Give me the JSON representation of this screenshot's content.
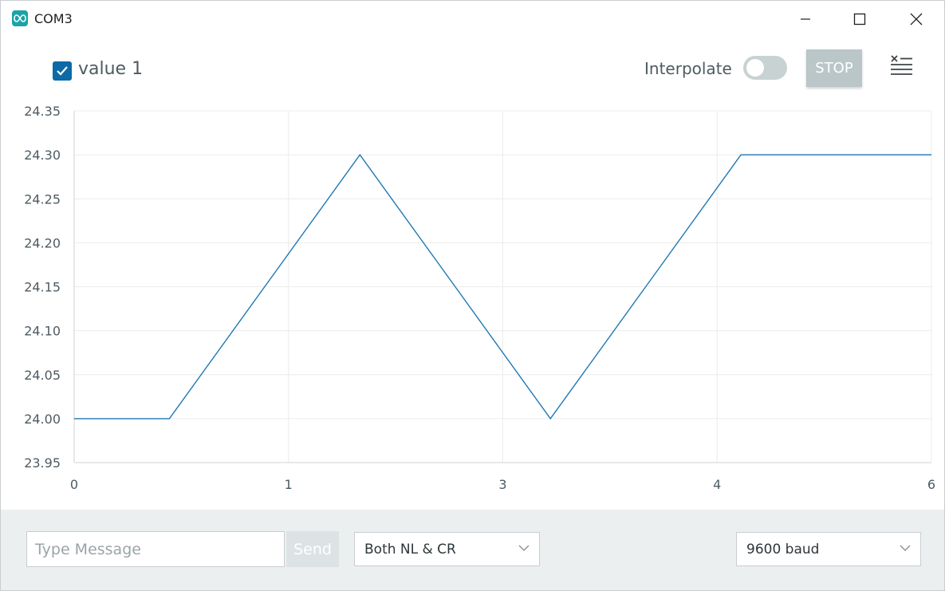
{
  "window": {
    "title": "COM3"
  },
  "toolbar": {
    "series_label": "value 1",
    "series_checked": true,
    "interpolate_label": "Interpolate",
    "interpolate_on": false,
    "stop_label": "STOP"
  },
  "footer": {
    "message_placeholder": "Type Message",
    "send_label": "Send",
    "line_ending": "Both NL & CR",
    "baud_rate": "9600 baud"
  },
  "colors": {
    "series": "#1f78b4",
    "accent": "#0d6aa6",
    "grid": "#ececec"
  },
  "chart_data": {
    "type": "line",
    "title": "",
    "xlabel": "",
    "ylabel": "",
    "x_ticks": [
      "0",
      "1",
      "3",
      "4",
      "6"
    ],
    "y_ticks": [
      "24.35",
      "24.30",
      "24.25",
      "24.20",
      "24.15",
      "24.10",
      "24.05",
      "24.00",
      "23.95"
    ],
    "ylim": [
      23.95,
      24.35
    ],
    "grid": true,
    "series": [
      {
        "name": "value 1",
        "values": [
          24.0,
          24.0,
          24.15,
          24.3,
          24.15,
          24.0,
          24.15,
          24.3,
          24.3,
          24.3
        ]
      }
    ]
  }
}
